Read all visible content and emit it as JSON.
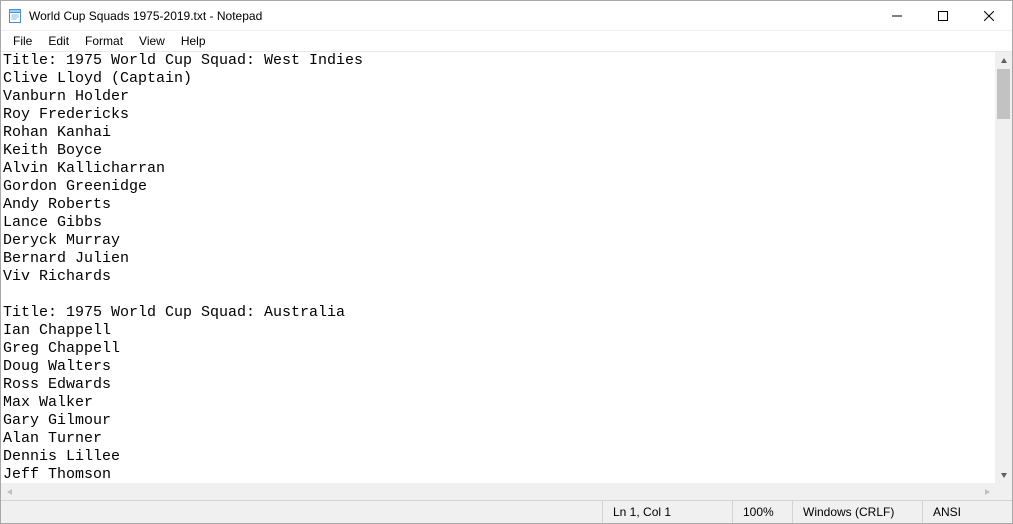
{
  "window": {
    "title": "World Cup Squads 1975-2019.txt - Notepad"
  },
  "menu": {
    "file": "File",
    "edit": "Edit",
    "format": "Format",
    "view": "View",
    "help": "Help"
  },
  "text_lines": [
    "Title: 1975 World Cup Squad: West Indies",
    "Clive Lloyd (Captain)",
    "Vanburn Holder",
    "Roy Fredericks",
    "Rohan Kanhai",
    "Keith Boyce",
    "Alvin Kallicharran",
    "Gordon Greenidge",
    "Andy Roberts",
    "Lance Gibbs",
    "Deryck Murray",
    "Bernard Julien",
    "Viv Richards",
    "",
    "Title: 1975 World Cup Squad: Australia",
    "Ian Chappell",
    "Greg Chappell",
    "Doug Walters",
    "Ross Edwards",
    "Max Walker",
    "Gary Gilmour",
    "Alan Turner",
    "Dennis Lillee",
    "Jeff Thomson"
  ],
  "status": {
    "cursor": "Ln 1, Col 1",
    "zoom": "100%",
    "line_ending": "Windows (CRLF)",
    "encoding": "ANSI"
  }
}
